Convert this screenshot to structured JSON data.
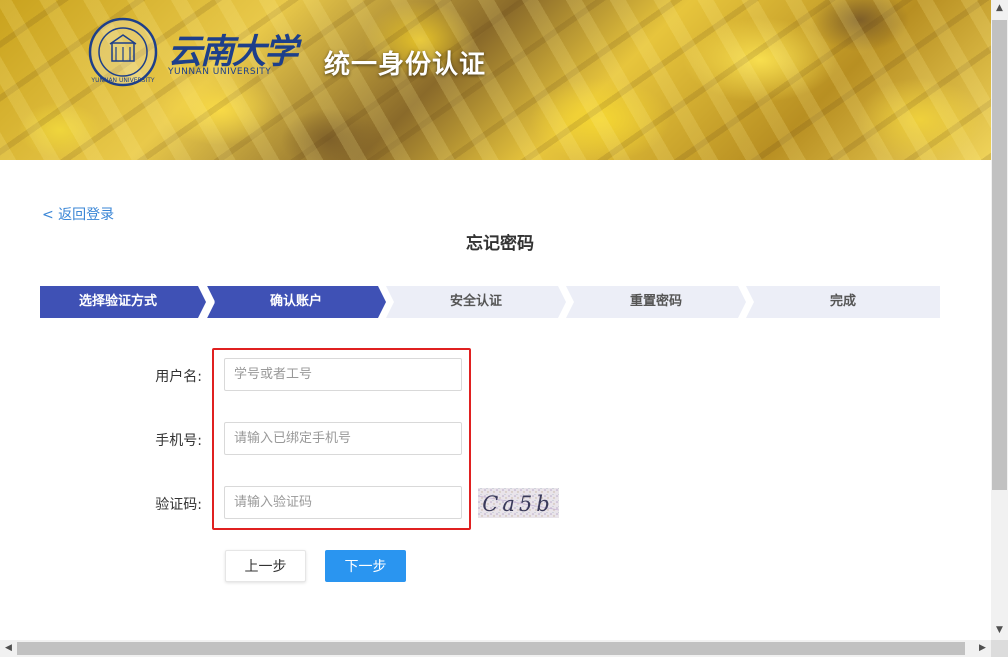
{
  "header": {
    "logo_cn": "云南大学",
    "logo_en": "YUNNAN UNIVERSITY",
    "seal_text": "YUNNAN UNIVERSITY",
    "title": "统一身份认证"
  },
  "nav": {
    "back_label": "< 返回登录"
  },
  "page": {
    "title": "忘记密码"
  },
  "steps": [
    {
      "label": "选择验证方式",
      "state": "active"
    },
    {
      "label": "确认账户",
      "state": "active"
    },
    {
      "label": "安全认证",
      "state": "inactive"
    },
    {
      "label": "重置密码",
      "state": "inactive"
    },
    {
      "label": "完成",
      "state": "inactive"
    }
  ],
  "form": {
    "username": {
      "label": "用户名:",
      "placeholder": "学号或者工号",
      "value": ""
    },
    "phone": {
      "label": "手机号:",
      "placeholder": "请输入已绑定手机号",
      "value": ""
    },
    "captcha": {
      "label": "验证码:",
      "placeholder": "请输入验证码",
      "value": "",
      "image_text": "Ca5b"
    }
  },
  "buttons": {
    "prev": "上一步",
    "next": "下一步"
  },
  "colors": {
    "step_active": "#3f51b5",
    "step_inactive": "#eceef7",
    "primary_button": "#2a95f0",
    "highlight_border": "#e02020",
    "link": "#3a86d6"
  },
  "scrollbars": {
    "up_icon": "▲",
    "down_icon": "▼",
    "left_icon": "◀",
    "right_icon": "▶"
  }
}
